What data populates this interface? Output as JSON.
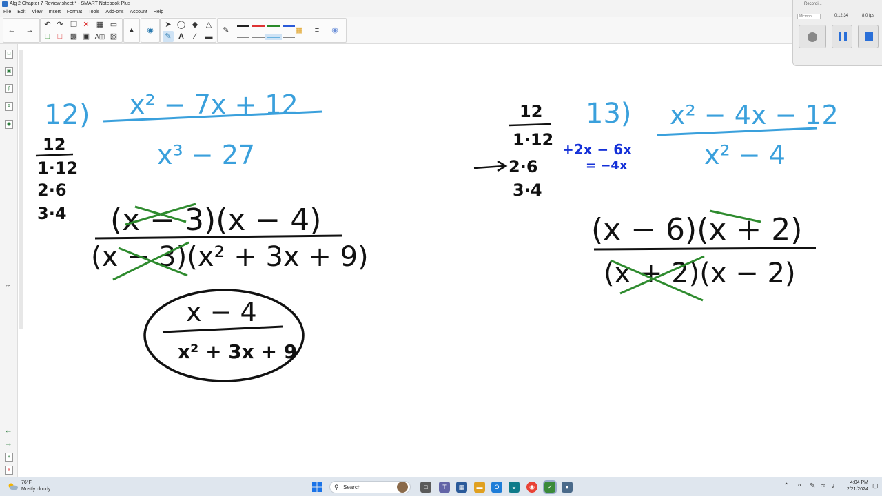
{
  "window": {
    "title": "Alg 2 Chapter 7 Review sheet * - SMART Notebook Plus"
  },
  "menu": [
    "File",
    "Edit",
    "View",
    "Insert",
    "Format",
    "Tools",
    "Add-ons",
    "Account",
    "Help"
  ],
  "recorder": {
    "title": "Recordi...",
    "source": "Microph...",
    "time": "0:12:34",
    "fps": "8.0 fps"
  },
  "colors": {
    "problem_blue": "#3aa0dc",
    "ink_black": "#111111",
    "cancel_green": "#2e8b2e",
    "marker_blue": "#1430d8"
  },
  "problem12": {
    "number": "12)",
    "numerator": "x² − 7x + 12",
    "denominator": "x³ − 27",
    "factor_pairs": {
      "title": "12",
      "pairs": [
        "1·12",
        "2·6",
        "3·4"
      ]
    },
    "factored_numerator": "(x − 3)(x − 4)",
    "factored_denominator": "(x − 3)(x² + 3x + 9)",
    "answer_numerator": "x − 4",
    "answer_denominator": "x² + 3x + 9"
  },
  "problem13": {
    "number": "13)",
    "numerator": "x² − 4x − 12",
    "denominator": "x² − 4",
    "factor_pairs": {
      "title": "12",
      "pairs": [
        "1·12",
        "2·6",
        "3·4"
      ]
    },
    "work_sum": "+2x − 6x",
    "work_result": "= −4x",
    "factored_numerator": "(x − 6)(x + 2)",
    "factored_denominator": "(x + 2)(x − 2)"
  },
  "taskbar": {
    "weather_temp": "76°F",
    "weather_condition": "Mostly cloudy",
    "search_label": "Search",
    "time": "4:04 PM",
    "date": "2/21/2024"
  }
}
